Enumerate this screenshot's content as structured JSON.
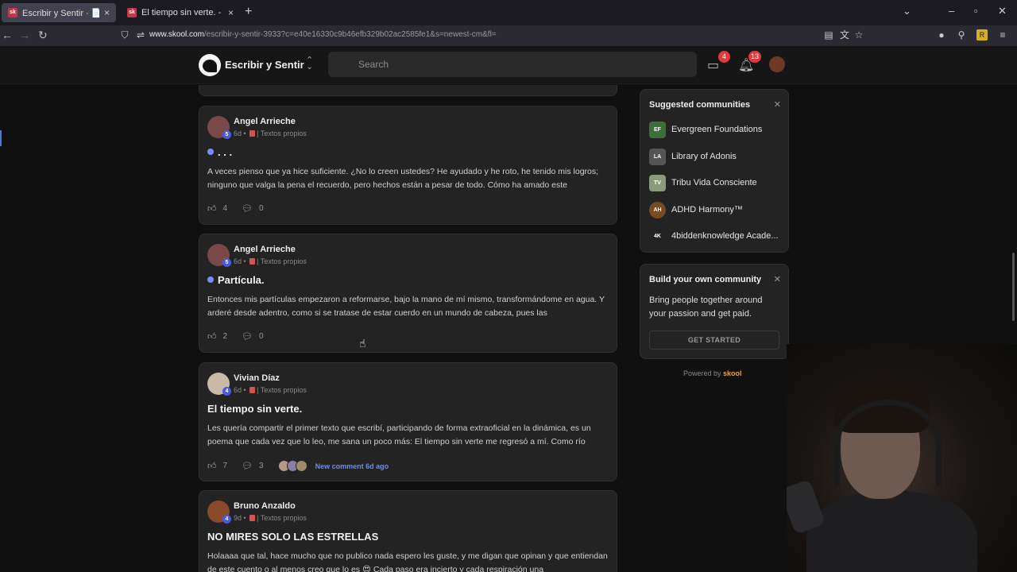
{
  "browser": {
    "tabs": [
      {
        "favicon": "sk",
        "title": "Escribir y Sentir · 📄 | Textos pr",
        "active": true
      },
      {
        "favicon": "sk",
        "title": "El tiempo sin verte. - Escribir y S",
        "active": false
      }
    ],
    "url_domain": "www.skool.com",
    "url_path": "/escribir-y-sentir-3933?c=e40e16330c9b46efb329b02ac2585fe1&s=newest-cm&fl="
  },
  "header": {
    "community_name": "Escribir y Sentir",
    "search_placeholder": "Search",
    "chat_badge": "4",
    "notif_badge": "13"
  },
  "posts": [
    {
      "author": "Angel Arrieche",
      "level": "5",
      "age": "6d",
      "category": "Textos propios",
      "title": ". . .",
      "unread": true,
      "body": "A veces pienso que ya hice suficiente. ¿No lo creen ustedes? He ayudado y he roto, he tenido mis logros; ninguno que valga la pena el recuerdo, pero hechos están a pesar de todo. Cómo ha amado este",
      "likes": "4",
      "comments": "0"
    },
    {
      "author": "Angel Arrieche",
      "level": "5",
      "age": "6d",
      "category": "Textos propios",
      "title": "Partícula.",
      "unread": true,
      "body": "Entonces mis partículas empezaron a reformarse, bajo la mano de mí mismo, transformándome en agua. Y arderé desde adentro, como si se tratase de estar cuerdo en un mundo de cabeza, pues las",
      "likes": "2",
      "comments": "0"
    },
    {
      "author": "Vivian Díaz",
      "level": "4",
      "age": "6d",
      "category": "Textos propios",
      "title": "El tiempo sin verte.",
      "unread": false,
      "body": "Les quería compartir el primer texto que escribí, participando de forma extraoficial en la dinámica, es un poema que cada vez que lo leo, me sana un poco más: El tiempo sin verte me regresó a mí. Como río",
      "likes": "7",
      "comments": "3",
      "new_comment": "New comment 6d ago"
    },
    {
      "author": "Bruno Anzaldo",
      "level": "4",
      "age": "9d",
      "category": "Textos propios",
      "title": "NO MIRES SOLO LAS ESTRELLAS",
      "unread": false,
      "body": "Holaaaa que tal, hace mucho que no publico nada espero les guste, y me digan que opinan y que entiendan de este cuento o al menos creo que lo es 😍 Cada paso era incierto y cada respiración una",
      "likes": "",
      "comments": ""
    }
  ],
  "suggested": {
    "heading": "Suggested communities",
    "items": [
      {
        "name": "Evergreen Foundations",
        "color": "#3c6e3a"
      },
      {
        "name": "Library of Adonis",
        "color": "#555555"
      },
      {
        "name": "Tribu Vida Consciente",
        "color": "#8a9a7a"
      },
      {
        "name": "ADHD Harmony™",
        "color": "#7a4a22"
      },
      {
        "name": "4biddenknowledge Acade...",
        "color": "#222222"
      }
    ]
  },
  "build": {
    "heading": "Build your own community",
    "text": "Bring people together around your passion and get paid.",
    "button": "GET STARTED"
  },
  "powered": {
    "label": "Powered by",
    "brand": "skool"
  }
}
